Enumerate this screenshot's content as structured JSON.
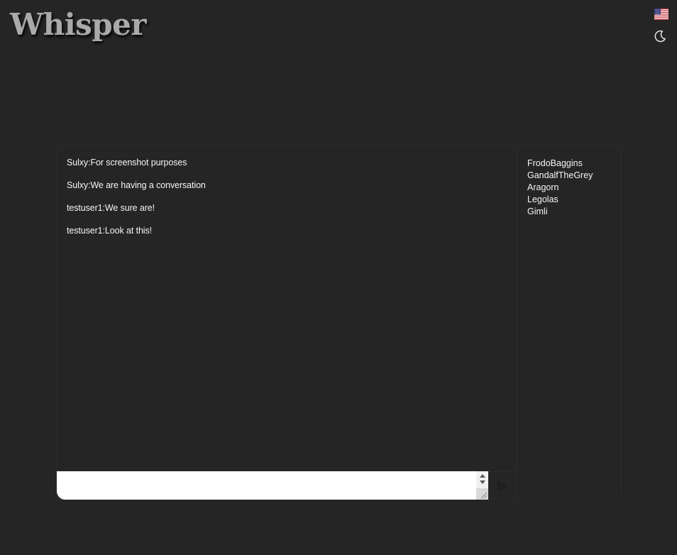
{
  "app": {
    "title": "Whisper"
  },
  "header": {
    "language_icon": "us-flag-icon",
    "theme_icon": "moon-icon"
  },
  "chat": {
    "messages": [
      {
        "text": "Sulxy:For screenshot purposes"
      },
      {
        "text": "Sulxy:We are having a conversation"
      },
      {
        "text": "testuser1:We sure are!"
      },
      {
        "text": "testuser1:Look at this!"
      }
    ],
    "input_value": "",
    "send_icon": "send-arrow-icon"
  },
  "users": [
    {
      "name": "FrodoBaggins"
    },
    {
      "name": "GandalfTheGrey"
    },
    {
      "name": "Aragorn"
    },
    {
      "name": "Legolas"
    },
    {
      "name": "Gimli"
    }
  ],
  "colors": {
    "background": "#252525",
    "text": "#f5f5f5",
    "brand": "#a9a9a9",
    "border": "#2c2c2c",
    "input": "#ffffff"
  }
}
